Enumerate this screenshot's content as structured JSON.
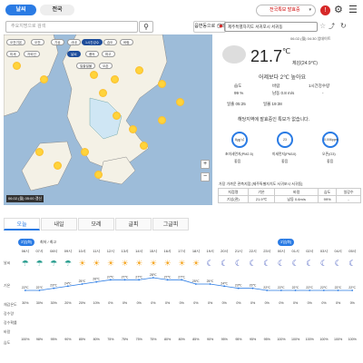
{
  "top_tabs": [
    {
      "label": "날씨"
    },
    {
      "label": "전국"
    }
  ],
  "search": {
    "placeholder": "주요지명으로 검색"
  },
  "select_area_label": "읍면동으로 선택",
  "alert_button": "전국특보 발효중",
  "address": "제주특별자치도 서귀포시 서귀동",
  "timestamp": "06.02.(월) 04:30 업데이트",
  "current": {
    "temp": "21.7",
    "unit": "℃",
    "feels": "체감(24.9℃)",
    "compare": "어제보다 2℃ 높아요"
  },
  "details": [
    {
      "label": "습도",
      "value": "99 %"
    },
    {
      "label": "바람",
      "value": "남동 0.8 m/s"
    },
    {
      "label": "1시간강수량",
      "value": "-"
    }
  ],
  "sun": {
    "rise_label": "일출",
    "rise": "05:25",
    "set_label": "일몰",
    "set": "19:38"
  },
  "no_alert": "해당지역에 발효중인 특보가 없습니다.",
  "air": [
    {
      "label": "초미세먼지(PM2.5)",
      "value": "좋음",
      "sub": "8㎍/㎥"
    },
    {
      "label": "미세먼지(PM10)",
      "value": "좋음",
      "sub": "23"
    },
    {
      "label": "오존(O3)",
      "value": "좋음",
      "sub": "0.006ppm"
    }
  ],
  "obs_title": "가장 가까운 관측지점 [제주특별자치도 서귀포시 서귀동]",
  "obs_table": {
    "headers": [
      "지점명",
      "기온",
      "바람",
      "습도",
      "일강수"
    ],
    "row": [
      "기상(관)",
      "21.9℃",
      "남동 0.6m/s",
      "99%",
      "-"
    ]
  },
  "map_chips": [
    "오전기온",
    "오전",
    "기상",
    "사내",
    "1시간강수",
    "습도",
    "바람",
    "날씨",
    "풍속",
    "파고",
    "미세",
    "자외선",
    "일출일몰",
    "오존"
  ],
  "map_time": "06.02.(월) 05:00 갱신",
  "bottom_tabs": [
    "오늘",
    "내일",
    "모레",
    "글피",
    "그글피"
  ],
  "hours": [
    "시각",
    "06시",
    "07시",
    "08시",
    "09시",
    "10시",
    "11시",
    "12시",
    "13시",
    "14시",
    "15시",
    "16시",
    "17시",
    "18시",
    "19시",
    "20시",
    "21시",
    "22시",
    "23시",
    "00시",
    "01시",
    "02시",
    "03시",
    "04시",
    "05시"
  ],
  "today_badge": "3일(화)",
  "tomorrow_badge": "3일(화)",
  "minmax": "최저 / 최고",
  "temps": [
    "22℃",
    "22℃",
    "23℃",
    "24℃",
    "25℃",
    "26℃",
    "27℃",
    "27℃",
    "27℃",
    "28℃",
    "27℃",
    "27℃",
    "25℃",
    "25℃",
    "24℃",
    "23℃",
    "23℃",
    "22℃",
    "22℃",
    "22℃",
    "22℃",
    "22℃",
    "22℃",
    "22℃"
  ],
  "humidity": [
    "100%",
    "98%",
    "95%",
    "90%",
    "85%",
    "80%",
    "75%",
    "75%",
    "75%",
    "75%",
    "80%",
    "80%",
    "85%",
    "90%",
    "95%",
    "95%",
    "95%",
    "95%",
    "100%",
    "100%",
    "100%",
    "100%",
    "100%",
    "100%"
  ],
  "rain_prob": [
    "30%",
    "30%",
    "30%",
    "20%",
    "20%",
    "10%",
    "0%",
    "0%",
    "0%",
    "0%",
    "0%",
    "0%",
    "0%",
    "0%",
    "0%",
    "0%",
    "0%",
    "0%",
    "0%",
    "0%",
    "0%",
    "0%",
    "0%",
    "0%"
  ],
  "row_labels": [
    "날씨",
    "기온",
    "체감온도",
    "강수량",
    "강수확률",
    "바람",
    "습도"
  ]
}
